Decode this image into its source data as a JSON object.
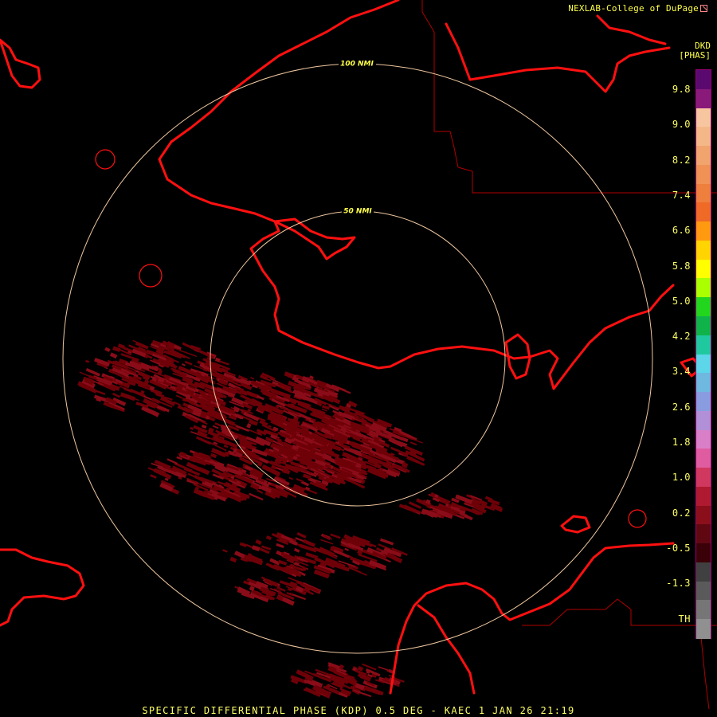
{
  "header": {
    "credit": "NEXLAB-College of DuPage",
    "logo_icon": "nexlab-logo-icon"
  },
  "legend": {
    "product_code": "DKD",
    "units": "[PHAS]",
    "labels": [
      "9.8",
      "9.0",
      "8.2",
      "7.4",
      "6.6",
      "5.8",
      "5.0",
      "4.2",
      "3.4",
      "2.6",
      "1.8",
      "1.0",
      "0.2",
      "-0.5",
      "-1.3",
      "TH"
    ],
    "colors": [
      "#5a0a6e",
      "#8a1a7a",
      "#f7c6a0",
      "#f4b888",
      "#f2a46e",
      "#f09256",
      "#ee7f3c",
      "#ee6a26",
      "#ff9a10",
      "#ffd400",
      "#ffff00",
      "#aaff00",
      "#22d61e",
      "#0fb34a",
      "#20c8a0",
      "#5cd6e8",
      "#6fb8e0",
      "#8a9ce0",
      "#b290d8",
      "#d87fc8",
      "#e05ca0",
      "#d03860",
      "#b01a30",
      "#8a0f1a",
      "#600812",
      "#3a0208",
      "#404040",
      "#5a5a5a",
      "#767676",
      "#909090"
    ],
    "outline_color": "#9b007a"
  },
  "map": {
    "rings": [
      {
        "label": "100 NMI"
      },
      {
        "label": "50 NMI"
      }
    ],
    "ring_color": "#f0c8a0",
    "coast_color": "#ff1010",
    "boundary_color": "#b00000",
    "echo_color": "#6e0008",
    "echo_color_light": "#8a0c18"
  },
  "footer": {
    "caption": "SPECIFIC DIFFERENTIAL PHASE (KDP) 0.5 DEG - KAEC 1 JAN 26 21:19"
  }
}
